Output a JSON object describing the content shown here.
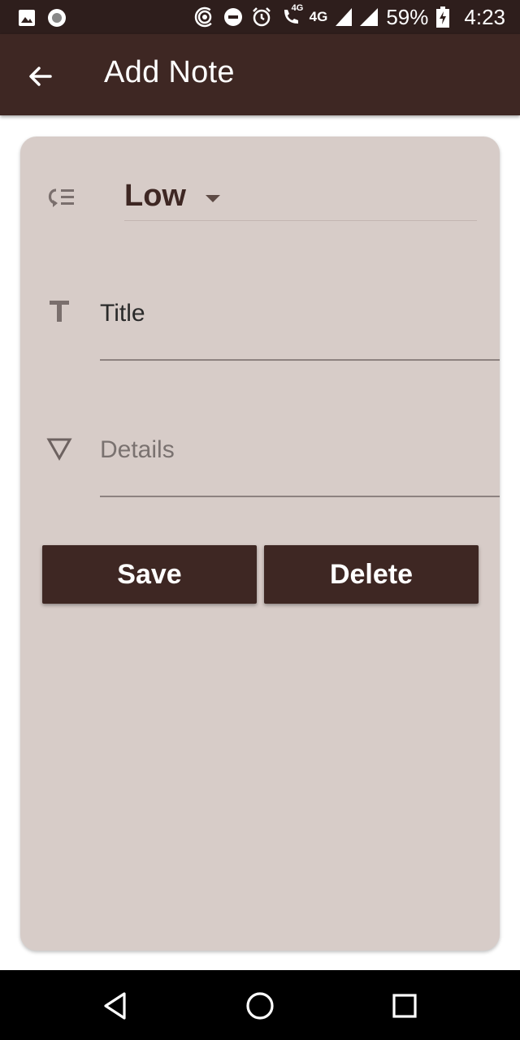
{
  "status_bar": {
    "network_label": "4G",
    "volte_label": "4G",
    "battery": "59%",
    "time": "4:23"
  },
  "app_bar": {
    "title": "Add Note",
    "back_icon": "arrow-left-icon"
  },
  "form": {
    "priority": {
      "icon": "priority-list-icon",
      "selected": "Low"
    },
    "title": {
      "icon": "text-title-icon",
      "placeholder": "Title",
      "value": ""
    },
    "details": {
      "icon": "triangle-down-icon",
      "placeholder": "Details",
      "value": ""
    },
    "buttons": {
      "save_label": "Save",
      "delete_label": "Delete"
    }
  },
  "colors": {
    "primary": "#3e2723",
    "card_background": "#d7ccc8",
    "status_bar": "#2e1e1c"
  }
}
